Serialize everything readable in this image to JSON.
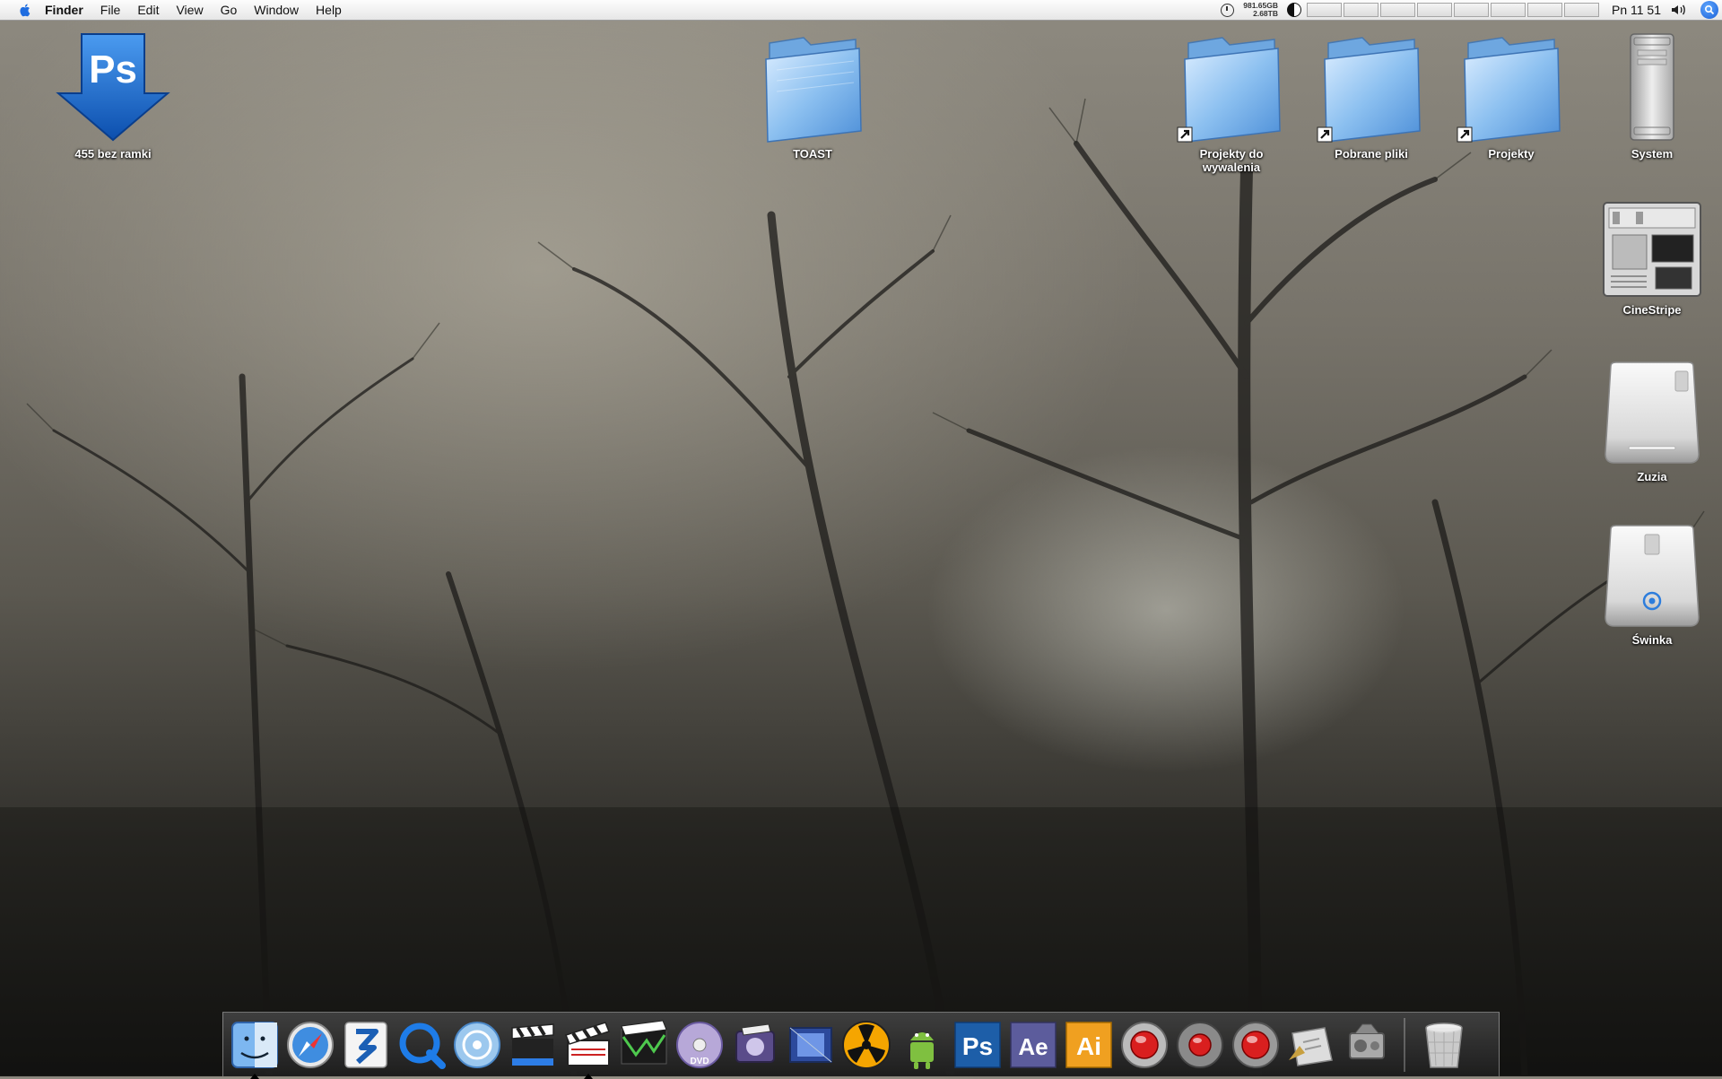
{
  "menubar": {
    "app_name": "Finder",
    "menus": [
      "File",
      "Edit",
      "View",
      "Go",
      "Window",
      "Help"
    ],
    "disk_stats": [
      "981.65GB",
      "2.68TB"
    ],
    "clock": "Pn 11 51"
  },
  "desktop": {
    "icons": [
      {
        "label": "455 bez  ramki",
        "icon": "photoshop-download-icon"
      },
      {
        "label": "TOAST",
        "icon": "folder-icon"
      },
      {
        "label": "Projekty do wywalenia",
        "icon": "folder-alias-icon"
      },
      {
        "label": "Pobrane pliki",
        "icon": "folder-alias-icon"
      },
      {
        "label": "Projekty",
        "icon": "folder-alias-icon"
      },
      {
        "label": "System",
        "icon": "mac-pro-icon"
      },
      {
        "label": "CineStripe",
        "icon": "disk-image-icon"
      },
      {
        "label": "Zuzia",
        "icon": "external-drive-icon"
      },
      {
        "label": "Świnka",
        "icon": "external-drive-icon"
      }
    ]
  },
  "dock": {
    "apps": [
      {
        "name": "finder-icon",
        "glyph": ""
      },
      {
        "name": "safari-icon",
        "glyph": ""
      },
      {
        "name": "adobe-bridge-icon",
        "glyph": ""
      },
      {
        "name": "quicktime-icon",
        "glyph": ""
      },
      {
        "name": "dvd-studio-icon",
        "glyph": ""
      },
      {
        "name": "final-cut-clapper-icon",
        "glyph": ""
      },
      {
        "name": "clapper-icon",
        "glyph": ""
      },
      {
        "name": "film-strip-icon",
        "glyph": ""
      },
      {
        "name": "dvd-player-icon",
        "glyph": ""
      },
      {
        "name": "media-app-icon",
        "glyph": ""
      },
      {
        "name": "compressor-icon",
        "glyph": ""
      },
      {
        "name": "nuke-icon",
        "glyph": ""
      },
      {
        "name": "android-icon",
        "glyph": ""
      },
      {
        "name": "photoshop-icon",
        "glyph": "Ps"
      },
      {
        "name": "after-effects-icon",
        "glyph": "Ae"
      },
      {
        "name": "illustrator-icon",
        "glyph": "Ai"
      },
      {
        "name": "record-button-icon-1",
        "glyph": ""
      },
      {
        "name": "record-button-icon-2",
        "glyph": ""
      },
      {
        "name": "record-button-icon-3",
        "glyph": ""
      },
      {
        "name": "applications-folder-icon",
        "glyph": ""
      },
      {
        "name": "utility-icon",
        "glyph": ""
      }
    ],
    "trash": "trash-icon"
  },
  "colors": {
    "folder_blue": "#7fb6ec",
    "ps_blue": "#1d5ea8",
    "ae_purple": "#5c5c9c",
    "ai_orange": "#f0a020"
  }
}
